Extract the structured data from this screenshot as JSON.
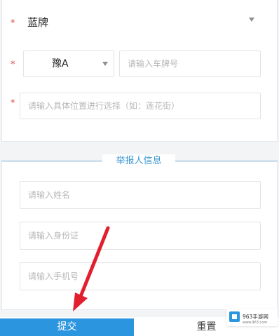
{
  "vehicle_form": {
    "required_mark": "*",
    "plate_color_value": "蓝牌",
    "province_value": "豫A",
    "plate_number_placeholder": "请输入车牌号",
    "location_placeholder": "请输入具体位置进行选择（如：莲花街）"
  },
  "reporter_section": {
    "title": "举报人信息",
    "name_placeholder": "请输入姓名",
    "id_card_placeholder": "请输入身份证",
    "phone_placeholder": "请输入手机号"
  },
  "actions": {
    "submit_label": "提交",
    "reset_label": "重置"
  },
  "watermark": {
    "logo": "963",
    "name": "963手游网",
    "url": "www.963.com"
  },
  "colors": {
    "accent": "#2b95e0",
    "section_title": "#3b97d3",
    "required": "#e04747",
    "annotation_arrow": "#e21f2f"
  }
}
